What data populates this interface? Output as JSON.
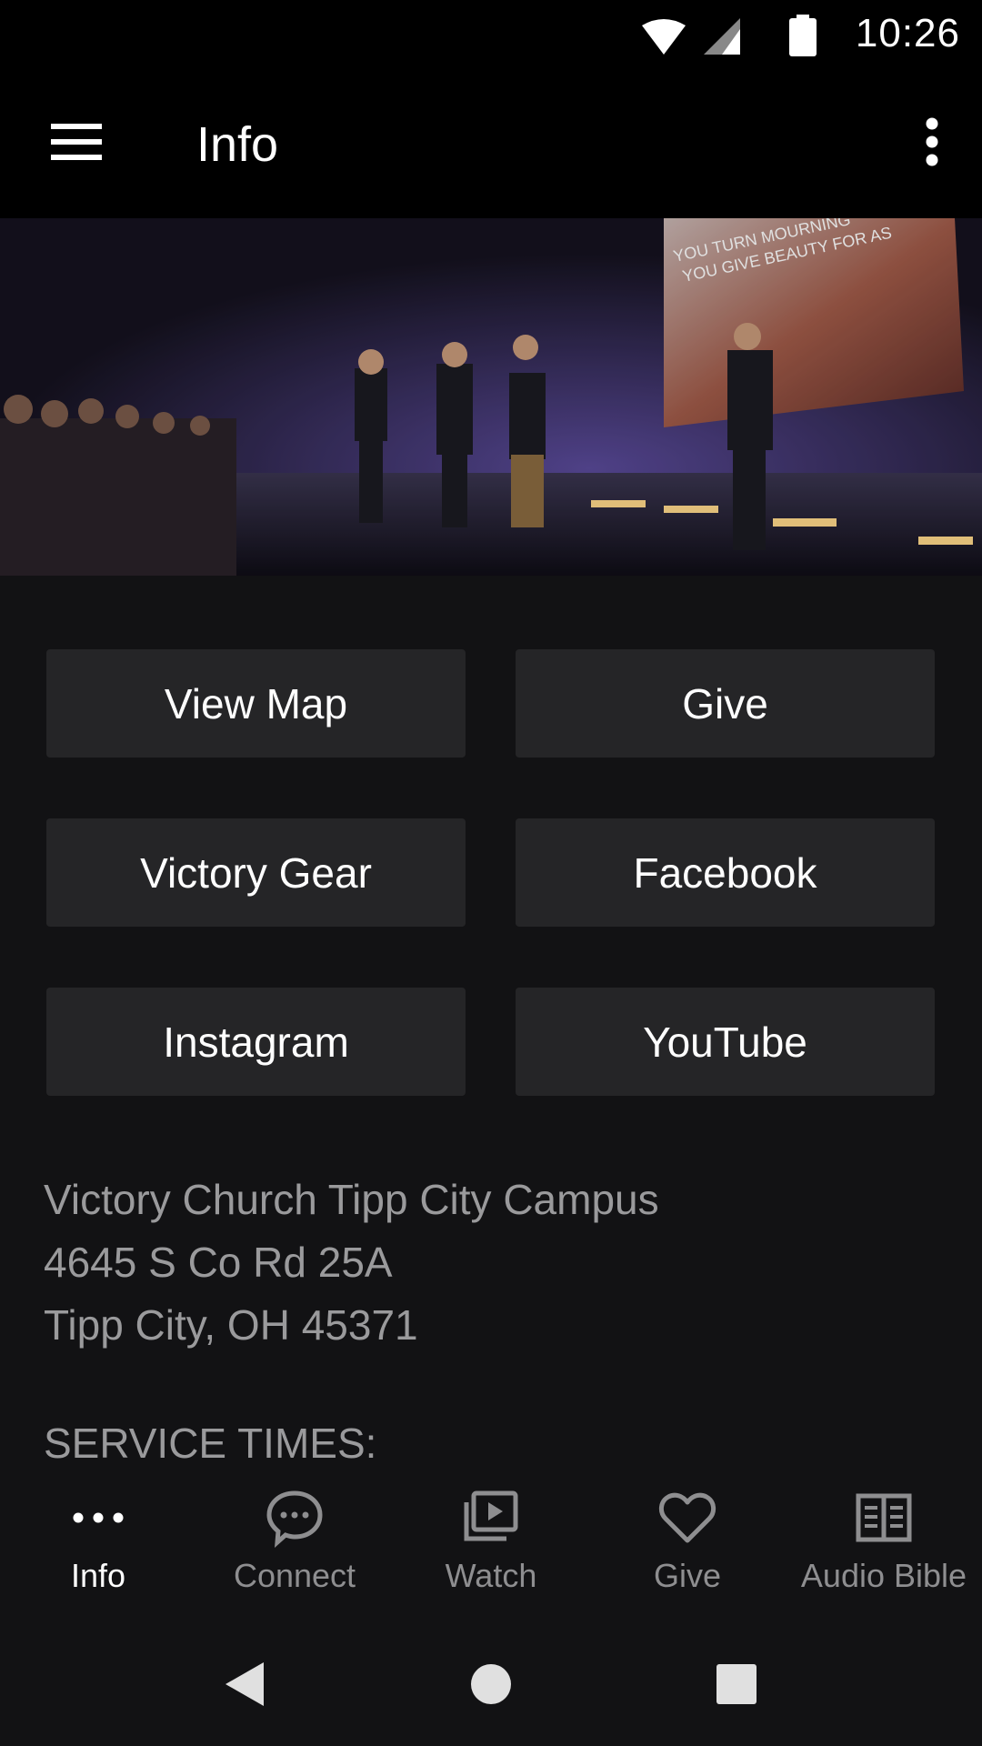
{
  "status_bar": {
    "time": "10:26"
  },
  "app_bar": {
    "title": "Info"
  },
  "buttons": [
    {
      "label": "View Map"
    },
    {
      "label": "Give"
    },
    {
      "label": "Victory Gear"
    },
    {
      "label": "Facebook"
    },
    {
      "label": "Instagram"
    },
    {
      "label": "YouTube"
    }
  ],
  "address": {
    "line1": "Victory Church Tipp City Campus",
    "line2": "4645 S Co Rd 25A",
    "line3": "Tipp City, OH 45371"
  },
  "service_times": {
    "title": "SERVICE TIMES:"
  },
  "hero": {
    "screen_line1": "YOU TURN MOURNING",
    "screen_line2": "YOU GIVE BEAUTY FOR AS"
  },
  "bottom_nav": {
    "items": [
      {
        "label": "Info",
        "icon": "more-dots-icon",
        "active": true
      },
      {
        "label": "Connect",
        "icon": "chat-bubble-icon",
        "active": false
      },
      {
        "label": "Watch",
        "icon": "video-library-icon",
        "active": false
      },
      {
        "label": "Give",
        "icon": "heart-icon",
        "active": false
      },
      {
        "label": "Audio Bible",
        "icon": "book-icon",
        "active": false
      }
    ]
  },
  "colors": {
    "background": "#121214",
    "button": "#252527",
    "muted_text": "#9a9a9c",
    "bar": "#000000"
  }
}
